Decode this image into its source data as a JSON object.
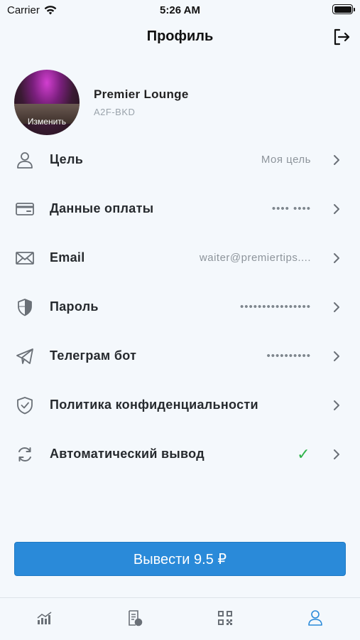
{
  "status_bar": {
    "carrier": "Carrier",
    "time": "5:26 AM",
    "icons": [
      "wifi-icon",
      "battery-icon"
    ]
  },
  "header": {
    "title": "Профиль",
    "logout_icon": "logout-icon"
  },
  "profile": {
    "name": "Premier Lounge",
    "code": "A2F-BKD",
    "avatar_edit_label": "Изменить"
  },
  "menu": {
    "items": [
      {
        "icon": "user-icon",
        "label": "Цель",
        "value": "Моя цель"
      },
      {
        "icon": "card-icon",
        "label": "Данные оплаты",
        "value": "•••• ••••"
      },
      {
        "icon": "mail-icon",
        "label": "Email",
        "value": "waiter@premiertips...."
      },
      {
        "icon": "shield-icon",
        "label": "Пароль",
        "value": "••••••••••••••••"
      },
      {
        "icon": "telegram-icon",
        "label": "Телеграм бот",
        "value": "••••••••••"
      },
      {
        "icon": "shield-check-icon",
        "label": "Политика конфиденциальности",
        "value": ""
      },
      {
        "icon": "refresh-icon",
        "label": "Автоматический вывод",
        "value": "✓"
      }
    ]
  },
  "withdraw_button": {
    "label": "Вывести 9.5 ₽"
  },
  "tab_bar": {
    "tabs": [
      {
        "icon": "chart-icon",
        "active": false
      },
      {
        "icon": "receipt-icon",
        "active": false
      },
      {
        "icon": "qr-code-icon",
        "active": false
      },
      {
        "icon": "profile-icon",
        "active": true
      }
    ]
  },
  "colors": {
    "background": "#f4f8fc",
    "accent": "#2a8ad9",
    "check": "#2fb34a",
    "icon": "#6a7077"
  }
}
